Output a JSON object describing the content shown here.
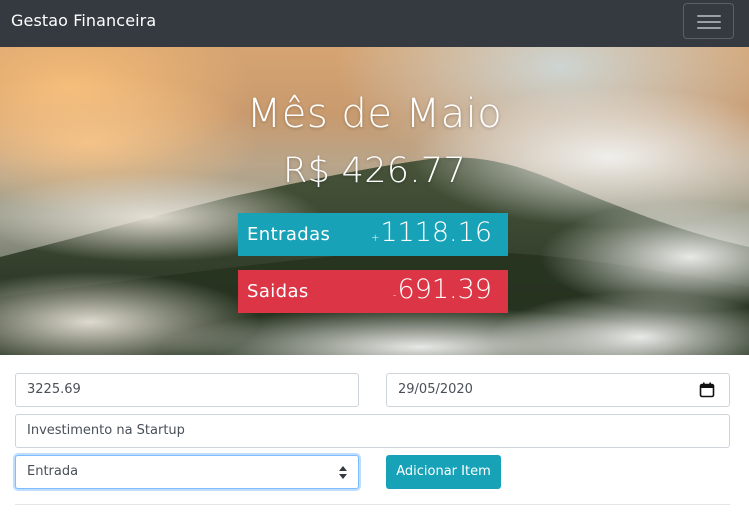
{
  "navbar": {
    "brand": "Gestao Financeira",
    "menu_icon": "hamburger-menu-icon"
  },
  "hero": {
    "title": "Mês de Maio",
    "total": "R$ 426.77",
    "income": {
      "label": "Entradas",
      "sign": "+",
      "value": "1118.16",
      "color": "#17a2b8"
    },
    "expense": {
      "label": "Saidas",
      "sign": "-",
      "value": "691.39",
      "color": "#dc3545"
    }
  },
  "form": {
    "amount_value": "3225.69",
    "date_value": "29/05/2020",
    "date_icon": "calendar-icon",
    "description_value": "Investimento na Startup",
    "type_selected": "Entrada",
    "type_icon": "select-arrows-icon",
    "submit_label": "Adicionar Item",
    "accent_color": "#17a2b8"
  }
}
